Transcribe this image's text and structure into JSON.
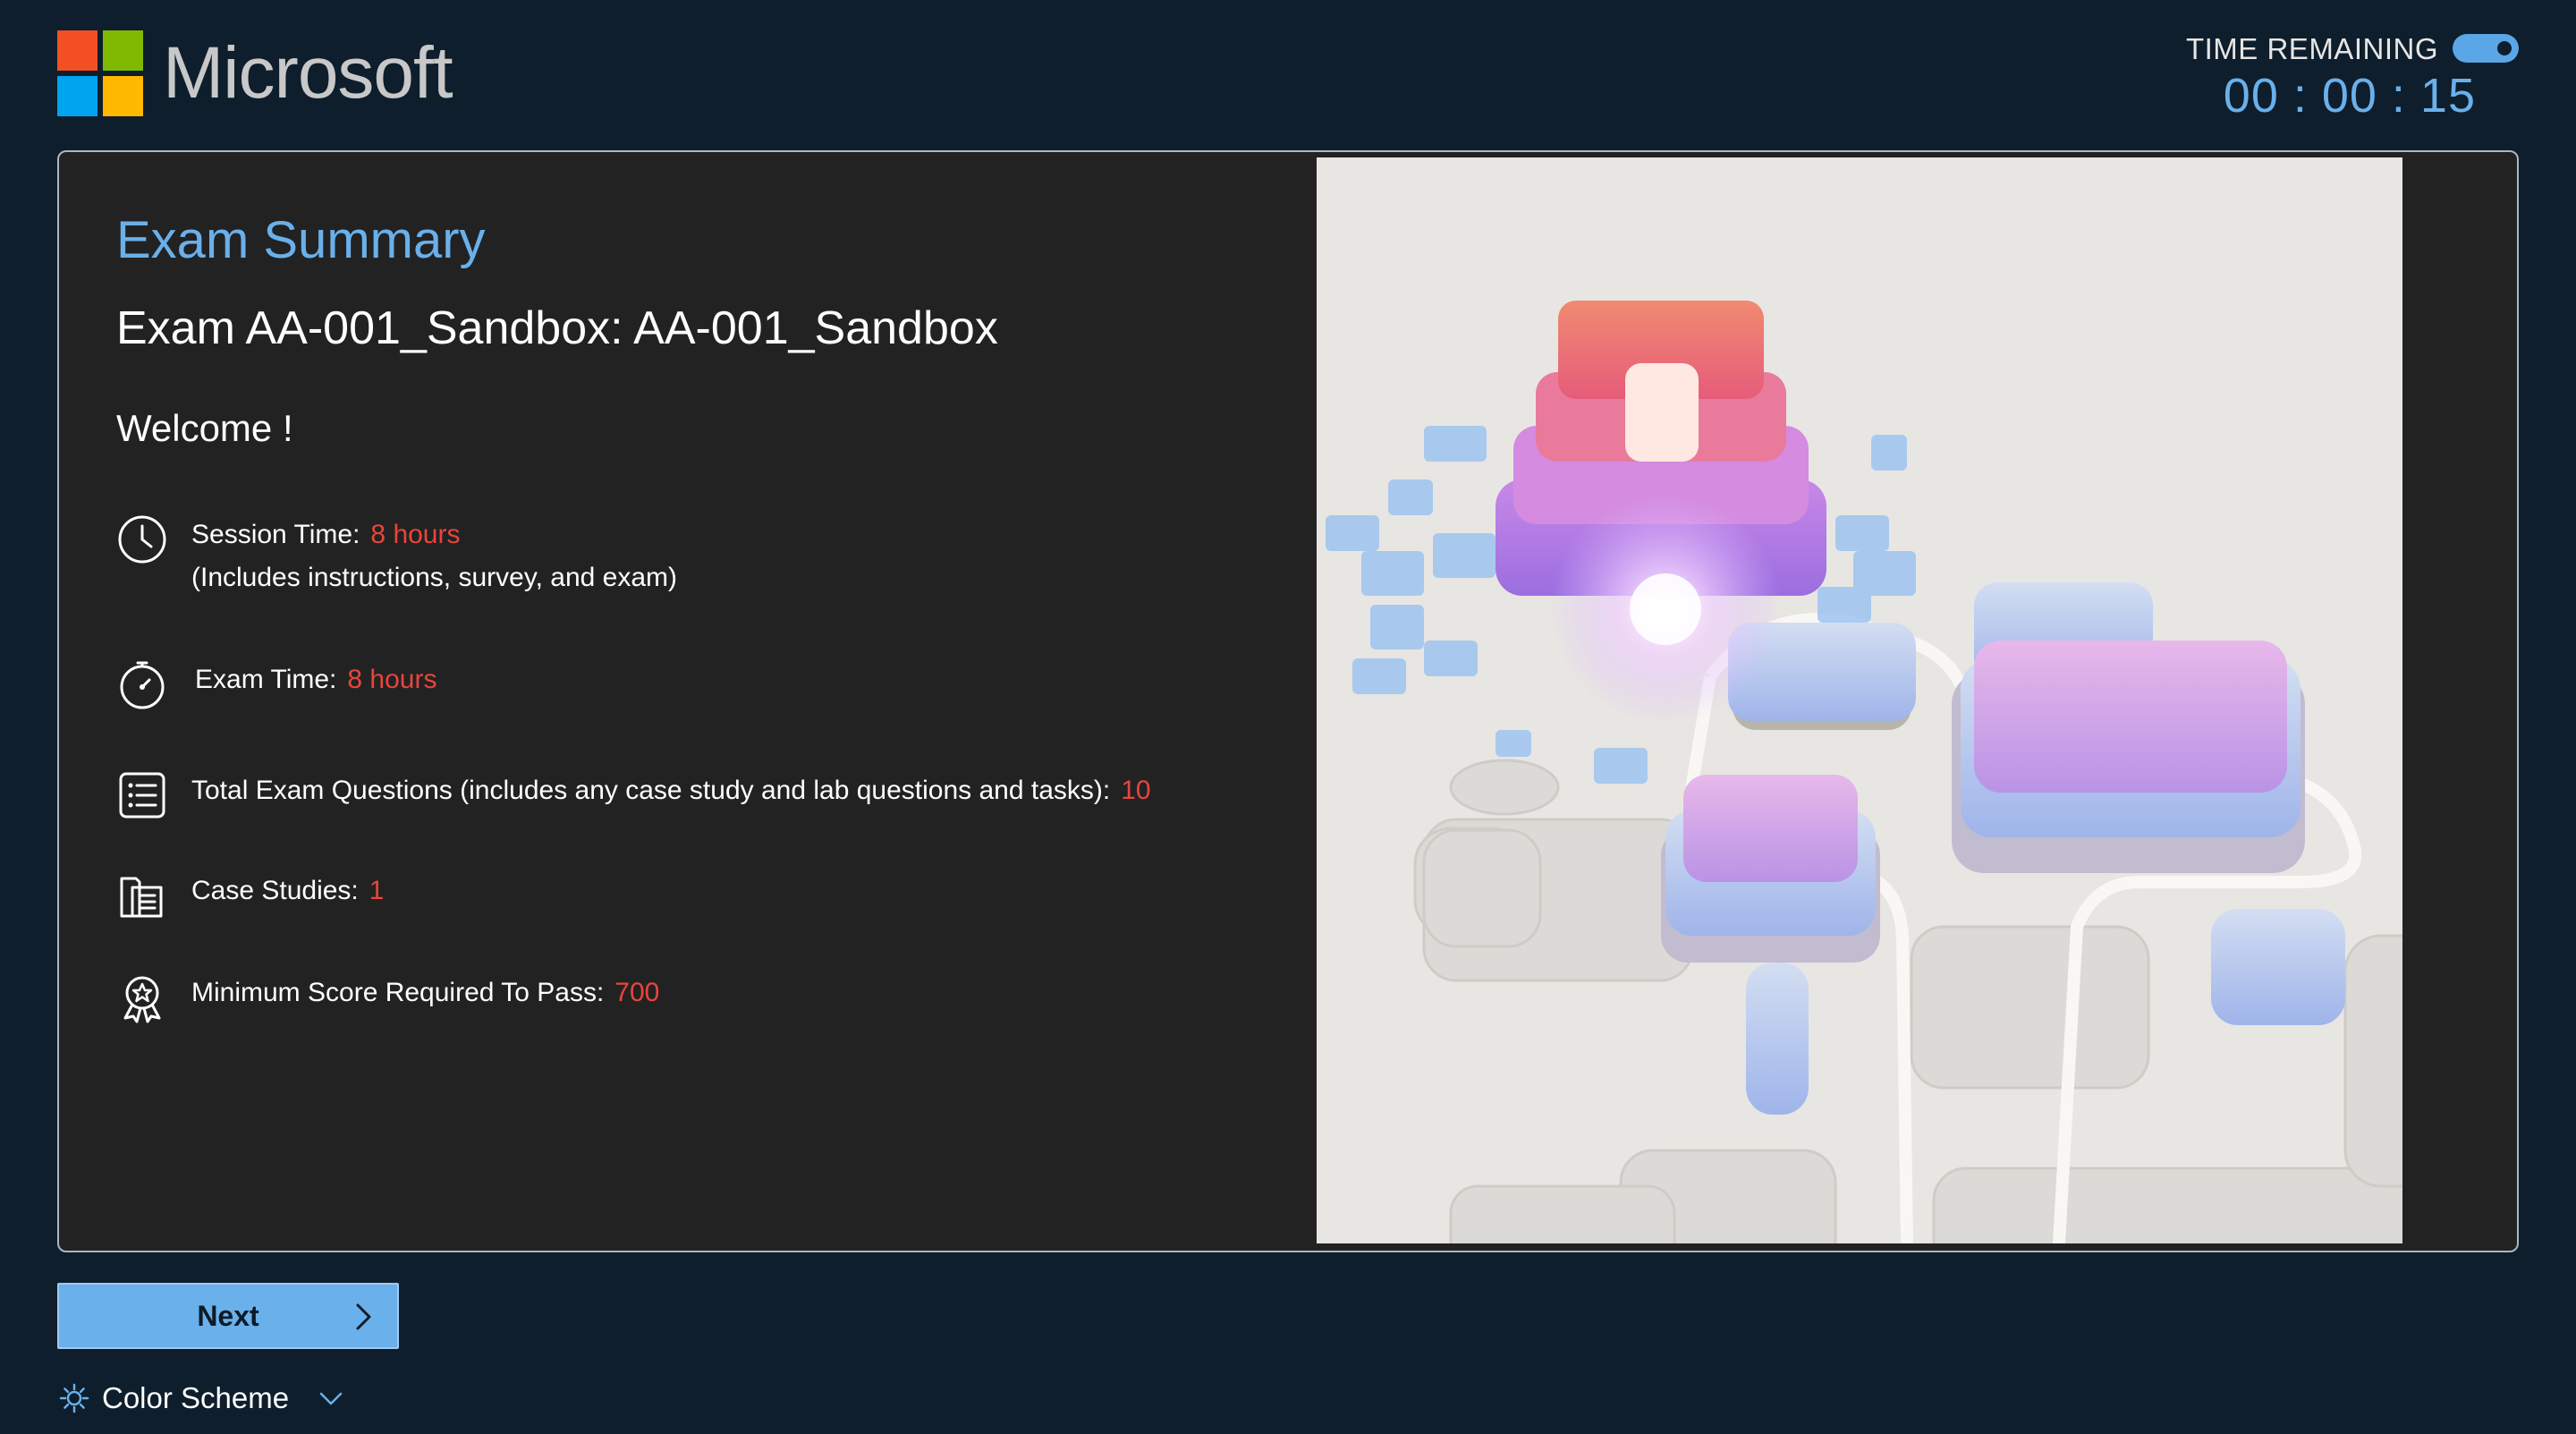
{
  "header": {
    "brand": "Microsoft",
    "brand_colors": [
      "#f25022",
      "#7fba00",
      "#00a4ef",
      "#ffb900"
    ],
    "timer_label": "TIME REMAINING",
    "timer_value": "00 : 00 : 15",
    "timer_toggle_on": true
  },
  "summary": {
    "heading": "Exam Summary",
    "exam_name": "Exam AA-001_Sandbox: AA-001_Sandbox",
    "welcome": "Welcome  !"
  },
  "items": [
    {
      "icon": "clock-icon",
      "label": "Session Time:",
      "value": "8 hours",
      "sub": "(Includes instructions, survey, and exam)"
    },
    {
      "icon": "stopwatch-icon",
      "label": "Exam Time:",
      "value": "8 hours"
    },
    {
      "icon": "checklist-icon",
      "label": "Total Exam Questions (includes any case study and lab questions and tasks):",
      "value": "10"
    },
    {
      "icon": "case-study-icon",
      "label": "Case Studies:",
      "value": "1"
    },
    {
      "icon": "award-icon",
      "label": "Minimum Score Required To Pass:",
      "value": "700"
    }
  ],
  "actions": {
    "next_label": "Next"
  },
  "footer": {
    "color_scheme_label": "Color Scheme"
  },
  "colors": {
    "background": "#0e1e2c",
    "card": "#222222",
    "accent": "#6ab0ea",
    "value": "#e8453c"
  }
}
